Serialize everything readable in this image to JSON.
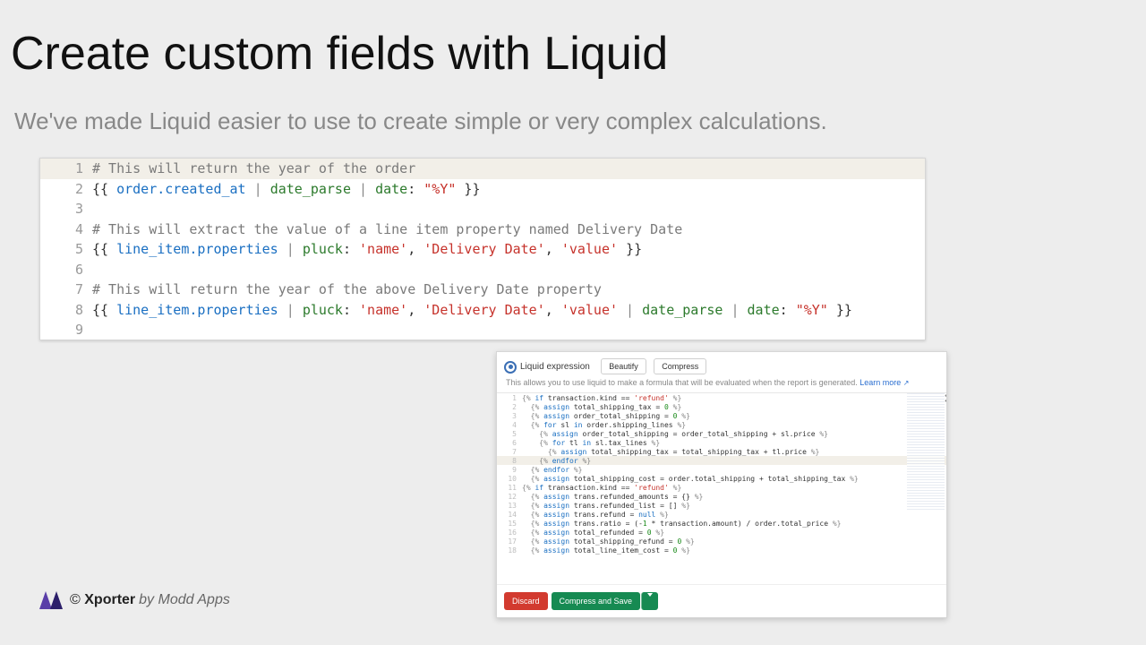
{
  "title": "Create custom fields with Liquid",
  "subtitle": "We've made Liquid easier to use to create simple or very complex calculations.",
  "code": {
    "l1": {
      "n": "1",
      "txt": "# This will return the year of the order"
    },
    "l2": {
      "n": "2",
      "a": "{{ ",
      "b": "order.created_at",
      "c": " | ",
      "d": "date_parse",
      "e": " | ",
      "f": "date",
      "g": ": ",
      "h": "\"%Y\"",
      "i": " }}"
    },
    "l3": {
      "n": "3"
    },
    "l4": {
      "n": "4",
      "txt": "# This will extract the value of a line item property named Delivery Date"
    },
    "l5": {
      "n": "5",
      "a": "{{ ",
      "b": "line_item.properties",
      "c": " | ",
      "d": "pluck",
      "e": ": ",
      "f": "'name'",
      "g": ", ",
      "h": "'Delivery Date'",
      "i": ", ",
      "j": "'value'",
      "k": " }}"
    },
    "l6": {
      "n": "6"
    },
    "l7": {
      "n": "7",
      "txt": "# This will return the year of the above Delivery Date property"
    },
    "l8": {
      "n": "8",
      "a": "{{ ",
      "b": "line_item.properties",
      "c": " | ",
      "d": "pluck",
      "e": ": ",
      "f": "'name'",
      "g": ", ",
      "h": "'Delivery Date'",
      "i": ", ",
      "j": "'value'",
      "k": " | ",
      "l": "date_parse",
      "m": " | ",
      "n_": "date",
      "o": ": ",
      "p": "\"%Y\"",
      "q": " }}"
    },
    "l9": {
      "n": "9"
    }
  },
  "panel": {
    "option": "Liquid expression",
    "beautify": "Beautify",
    "compress": "Compress",
    "help": "This allows you to use liquid to make a formula that will be evaluated when the report is generated.",
    "learn": "Learn more",
    "discard": "Discard",
    "save": "Compress and Save"
  },
  "editor": {
    "lines": [
      {
        "n": "1",
        "t": "{% if transaction.kind == 'refund' %}"
      },
      {
        "n": "2",
        "t": "  {% assign total_shipping_tax = 0 %}"
      },
      {
        "n": "3",
        "t": "  {% assign order_total_shipping = 0 %}"
      },
      {
        "n": "4",
        "t": "  {% for sl in order.shipping_lines %}"
      },
      {
        "n": "5",
        "t": "    {% assign order_total_shipping = order_total_shipping + sl.price %}"
      },
      {
        "n": "6",
        "t": "    {% for tl in sl.tax_lines %}"
      },
      {
        "n": "7",
        "t": "      {% assign total_shipping_tax = total_shipping_tax + tl.price %}"
      },
      {
        "n": "8",
        "t": "    {% endfor %}"
      },
      {
        "n": "9",
        "t": "  {% endfor %}"
      },
      {
        "n": "10",
        "t": "  {% assign total_shipping_cost = order.total_shipping + total_shipping_tax %}"
      },
      {
        "n": "11",
        "t": "{% if transaction.kind == 'refund' %}"
      },
      {
        "n": "12",
        "t": "  {% assign trans.refunded_amounts = {} %}"
      },
      {
        "n": "13",
        "t": "  {% assign trans.refunded_list = [] %}"
      },
      {
        "n": "14",
        "t": "  {% assign trans.refund = null %}"
      },
      {
        "n": "15",
        "t": "  {% assign trans.ratio = (-1 * transaction.amount) / order.total_price %}"
      },
      {
        "n": "16",
        "t": "  {% assign total_refunded = 0 %}"
      },
      {
        "n": "17",
        "t": "  {% assign total_shipping_refund = 0 %}"
      },
      {
        "n": "18",
        "t": "  {% assign total_line_item_cost = 0 %}"
      }
    ]
  },
  "footer": {
    "copyright": "©",
    "name": "Xporter",
    "by": "by Modd Apps"
  }
}
